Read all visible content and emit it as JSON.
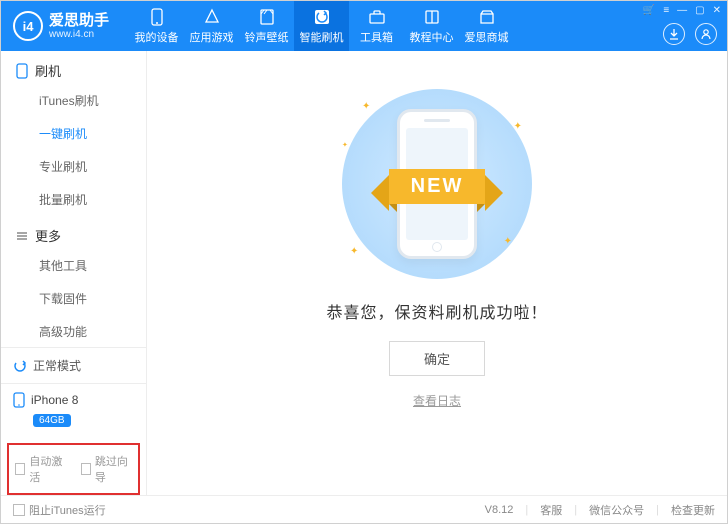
{
  "brand": {
    "name": "爱思助手",
    "url": "www.i4.cn",
    "logo_text": "i4"
  },
  "window_controls": {
    "cart": "🛒",
    "menu": "≡",
    "min": "—",
    "max": "▢",
    "close": "✕"
  },
  "top_nav": [
    {
      "label": "我的设备",
      "icon": "phone"
    },
    {
      "label": "应用游戏",
      "icon": "apps"
    },
    {
      "label": "铃声壁纸",
      "icon": "note"
    },
    {
      "label": "智能刷机",
      "icon": "flash",
      "active": true
    },
    {
      "label": "工具箱",
      "icon": "toolbox"
    },
    {
      "label": "教程中心",
      "icon": "book"
    },
    {
      "label": "爱思商城",
      "icon": "store"
    }
  ],
  "sidebar": {
    "sections": [
      {
        "title": "刷机",
        "icon": "phone-outline",
        "items": [
          {
            "label": "iTunes刷机"
          },
          {
            "label": "一键刷机",
            "active": true
          },
          {
            "label": "专业刷机"
          },
          {
            "label": "批量刷机"
          }
        ]
      },
      {
        "title": "更多",
        "icon": "more",
        "items": [
          {
            "label": "其他工具"
          },
          {
            "label": "下载固件"
          },
          {
            "label": "高级功能"
          }
        ]
      }
    ],
    "mode": {
      "label": "正常模式",
      "icon": "refresh"
    },
    "device": {
      "name": "iPhone 8",
      "capacity": "64GB"
    },
    "options": [
      {
        "label": "自动激活",
        "checked": false
      },
      {
        "label": "跳过向导",
        "checked": false
      }
    ]
  },
  "main": {
    "ribbon_text": "NEW",
    "success_message": "恭喜您，保资料刷机成功啦！",
    "confirm_label": "确定",
    "view_log_label": "查看日志"
  },
  "footer": {
    "block_itunes_label": "阻止iTunes运行",
    "version": "V8.12",
    "support": "客服",
    "wechat": "微信公众号",
    "update": "检查更新"
  }
}
